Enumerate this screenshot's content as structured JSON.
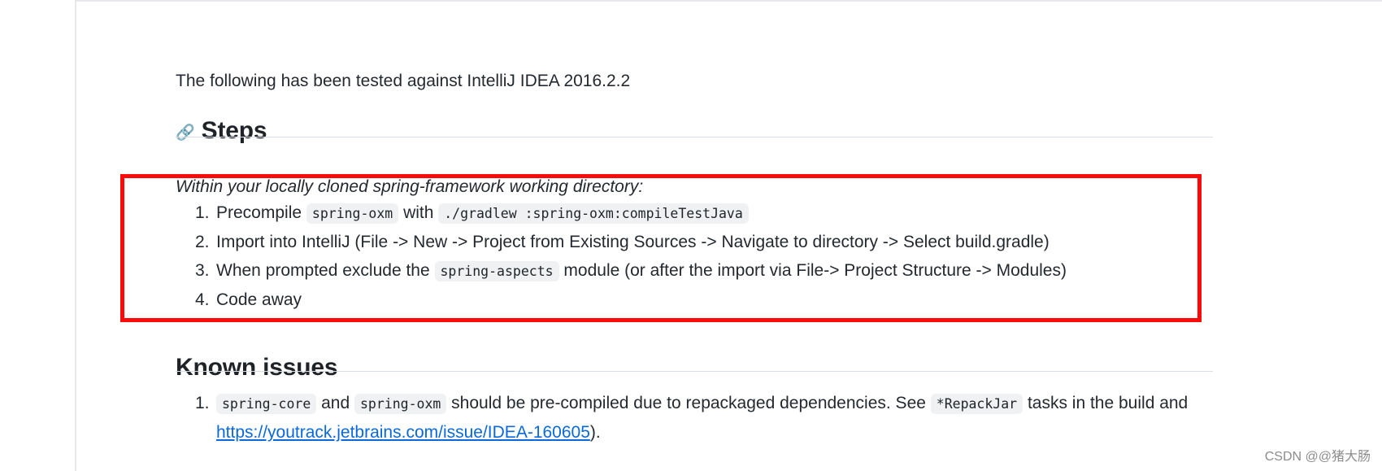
{
  "document": {
    "intro_paragraph": "The following has been tested against IntelliJ IDEA 2016.2.2",
    "steps_heading": "Steps",
    "anchor_link_glyph": "🔗",
    "steps_intro_italic": "Within your locally cloned spring-framework working directory:",
    "steps": [
      {
        "marker": "1.",
        "parts": [
          {
            "type": "text",
            "value": "Precompile "
          },
          {
            "type": "code",
            "value": "spring-oxm"
          },
          {
            "type": "text",
            "value": " with "
          },
          {
            "type": "code",
            "value": "./gradlew :spring-oxm:compileTestJava"
          }
        ]
      },
      {
        "marker": "2.",
        "parts": [
          {
            "type": "text",
            "value": "Import into IntelliJ (File -> New -> Project from Existing Sources -> Navigate to directory -> Select build.gradle)"
          }
        ]
      },
      {
        "marker": "3.",
        "parts": [
          {
            "type": "text",
            "value": "When prompted exclude the "
          },
          {
            "type": "code",
            "value": "spring-aspects"
          },
          {
            "type": "text",
            "value": " module (or after the import via File-> Project Structure -> Modules)"
          }
        ]
      },
      {
        "marker": "4.",
        "parts": [
          {
            "type": "text",
            "value": "Code away"
          }
        ]
      }
    ],
    "known_issues_heading": "Known issues",
    "known_issues": [
      {
        "marker": "1.",
        "parts": [
          {
            "type": "code",
            "value": "spring-core"
          },
          {
            "type": "text",
            "value": " and "
          },
          {
            "type": "code",
            "value": "spring-oxm"
          },
          {
            "type": "text",
            "value": " should be pre-compiled due to repackaged dependencies. See "
          },
          {
            "type": "code",
            "value": "*RepackJar"
          },
          {
            "type": "text",
            "value": " tasks in the build and "
          },
          {
            "type": "link",
            "value": "https://youtrack.jetbrains.com/issue/IDEA-160605"
          },
          {
            "type": "text",
            "value": ")."
          }
        ]
      }
    ]
  },
  "annotation": {
    "red_box_color": "#fb0a0a"
  },
  "watermark": {
    "text": "CSDN @@猪大肠"
  }
}
